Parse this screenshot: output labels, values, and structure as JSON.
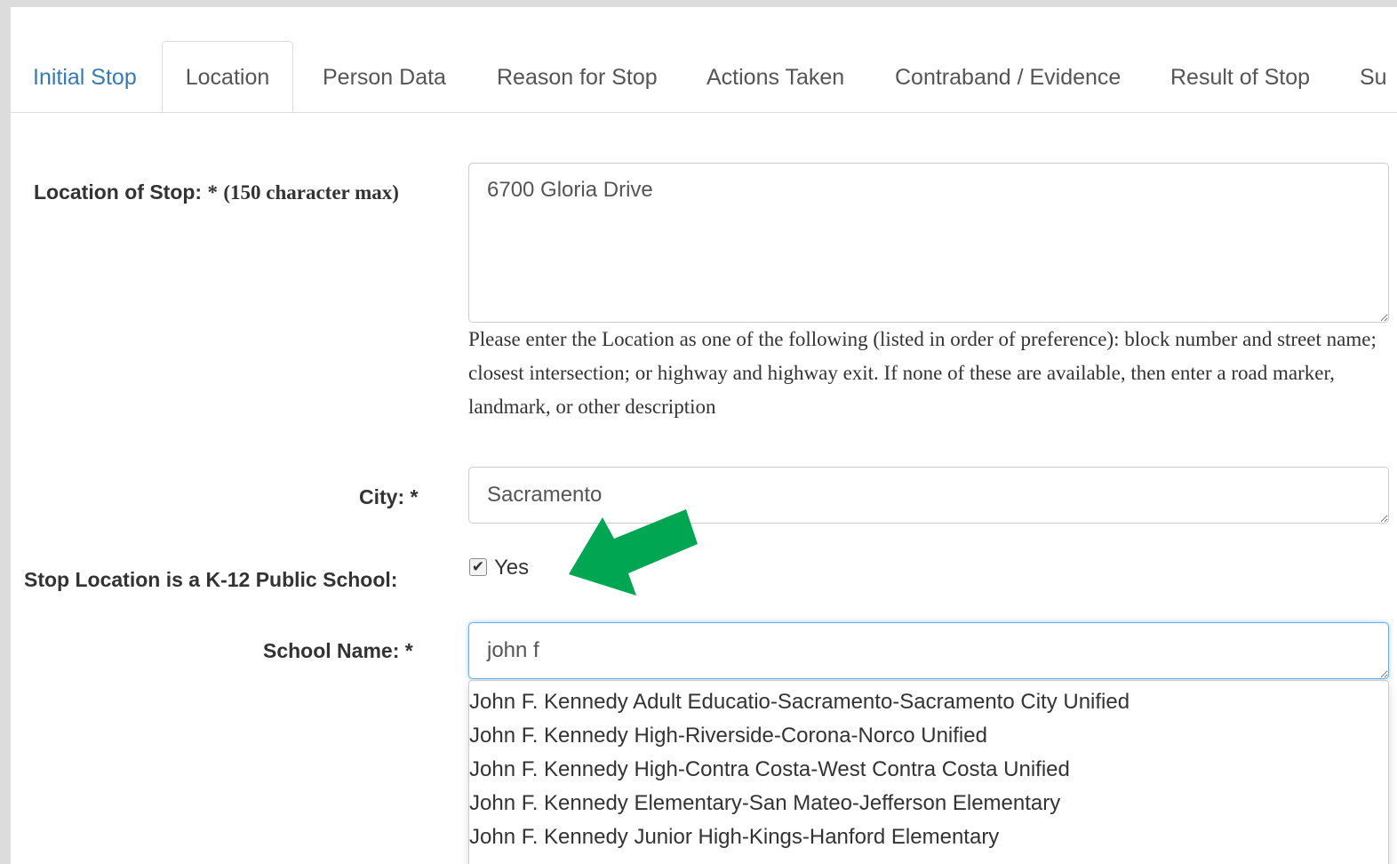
{
  "tabs": [
    {
      "label": "Initial Stop",
      "state": "link"
    },
    {
      "label": "Location",
      "state": "active"
    },
    {
      "label": "Person Data",
      "state": "default"
    },
    {
      "label": "Reason for Stop",
      "state": "default"
    },
    {
      "label": "Actions Taken",
      "state": "default"
    },
    {
      "label": "Contraband / Evidence",
      "state": "default"
    },
    {
      "label": "Result of Stop",
      "state": "default"
    },
    {
      "label": "Su",
      "state": "default"
    }
  ],
  "location": {
    "label": "Location of Stop:",
    "required_mark": "*",
    "note": "(150 character max)",
    "value": "6700 Gloria Drive",
    "help": "Please enter the Location as one of the following (listed in order of preference): block number and street name; closest intersection; or highway and highway exit. If none of these are available, then enter a road marker, landmark, or other description"
  },
  "city": {
    "label": "City: *",
    "value": "Sacramento"
  },
  "school_toggle": {
    "label": "Stop Location is a K-12 Public School:",
    "checked": true,
    "option_label": "Yes"
  },
  "school_name": {
    "label": "School Name: *",
    "value": "john f"
  },
  "suggestions": [
    "John F. Kennedy Adult Educatio-Sacramento-Sacramento City Unified",
    "John F. Kennedy High-Riverside-Corona-Norco Unified",
    "John F. Kennedy High-Contra Costa-West Contra Costa Unified",
    "John F. Kennedy Elementary-San Mateo-Jefferson Elementary",
    "John F. Kennedy Junior High-Kings-Hanford Elementary"
  ],
  "annotation": {
    "arrow_color": "#00a651"
  },
  "colors": {
    "link": "#337ab7",
    "focus_border": "#66afe9"
  }
}
